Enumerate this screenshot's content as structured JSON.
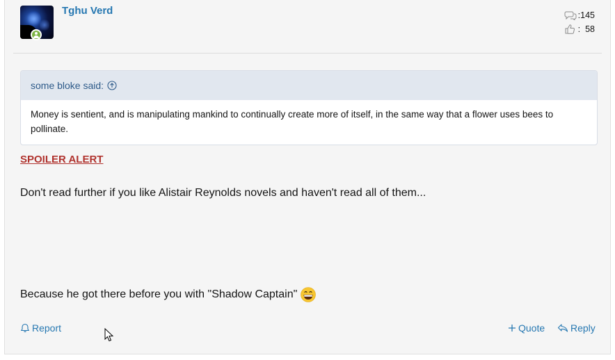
{
  "post": {
    "username": "Tghu Verd",
    "stats": {
      "messages": ":145",
      "reactions": ":  58"
    }
  },
  "quote": {
    "attribution": "some bloke said:",
    "text": "Money is sentient, and is manipulating mankind to continually create more of itself, in the same way that a flower uses bees to pollinate."
  },
  "body": {
    "spoiler": "SPOILER ALERT",
    "paragraph1": "Don't read further if you like Alistair Reynolds novels and haven't read all of them...",
    "paragraph2": "Because he got there before you with \"Shadow Captain\""
  },
  "actions": {
    "report": "Report",
    "quote": "Quote",
    "reply": "Reply"
  },
  "colors": {
    "link": "#2577b1",
    "spoiler": "#b0322d",
    "online": "#7cb342"
  }
}
